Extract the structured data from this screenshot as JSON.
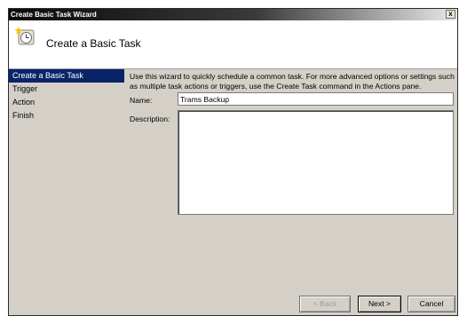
{
  "window": {
    "title": "Create Basic Task Wizard",
    "close_label": "x"
  },
  "header": {
    "title": "Create a Basic Task",
    "icon": "scheduled-task-clock-icon"
  },
  "steps": [
    {
      "label": "Create a Basic Task",
      "active": true
    },
    {
      "label": "Trigger",
      "active": false
    },
    {
      "label": "Action",
      "active": false
    },
    {
      "label": "Finish",
      "active": false
    }
  ],
  "intro_text": "Use this wizard to quickly schedule a common task.  For more advanced options or settings such as multiple task actions or triggers, use the Create Task command in the Actions pane.",
  "form": {
    "name_label": "Name:",
    "name_value": "Trams Backup",
    "description_label": "Description:",
    "description_value": ""
  },
  "buttons": {
    "back": "< Back",
    "next": "Next >",
    "cancel": "Cancel"
  },
  "colors": {
    "selection": "#0a246a",
    "dialog_bg": "#d4d0c8"
  }
}
